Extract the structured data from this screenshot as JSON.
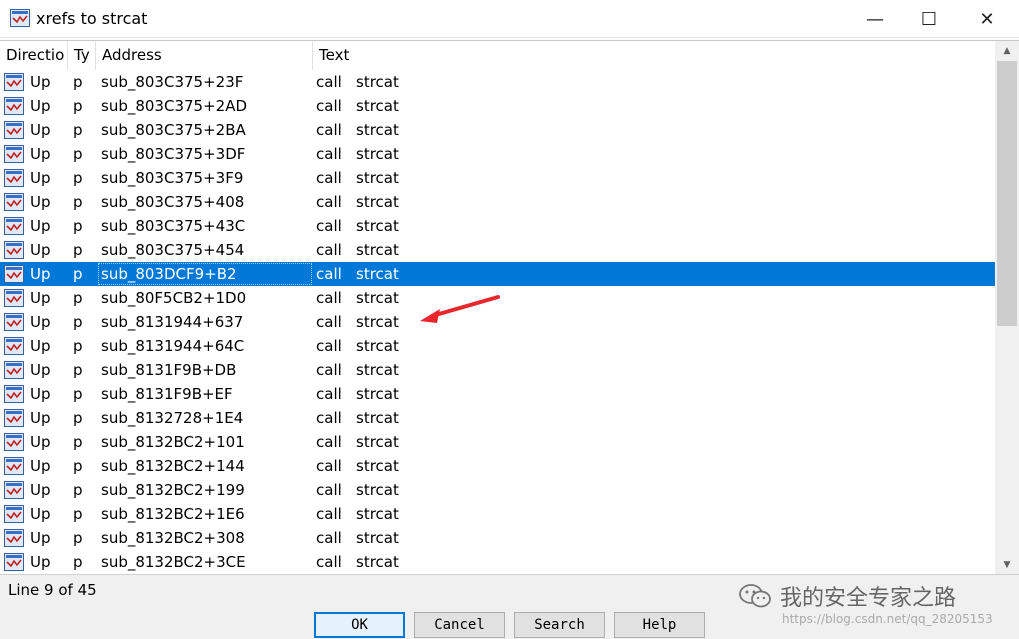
{
  "window": {
    "title": "xrefs to strcat",
    "min_glyph": "—",
    "max_glyph": "☐",
    "close_glyph": "✕",
    "icon": "xref-app-icon"
  },
  "columns": [
    "Directio",
    "Ty",
    "Address",
    "Text"
  ],
  "rows": [
    {
      "dir": "Up",
      "type": "p",
      "address": "sub_803C375+23F",
      "op": "call",
      "target": "strcat"
    },
    {
      "dir": "Up",
      "type": "p",
      "address": "sub_803C375+2AD",
      "op": "call",
      "target": "strcat"
    },
    {
      "dir": "Up",
      "type": "p",
      "address": "sub_803C375+2BA",
      "op": "call",
      "target": "strcat"
    },
    {
      "dir": "Up",
      "type": "p",
      "address": "sub_803C375+3DF",
      "op": "call",
      "target": "strcat"
    },
    {
      "dir": "Up",
      "type": "p",
      "address": "sub_803C375+3F9",
      "op": "call",
      "target": "strcat"
    },
    {
      "dir": "Up",
      "type": "p",
      "address": "sub_803C375+408",
      "op": "call",
      "target": "strcat"
    },
    {
      "dir": "Up",
      "type": "p",
      "address": "sub_803C375+43C",
      "op": "call",
      "target": "strcat"
    },
    {
      "dir": "Up",
      "type": "p",
      "address": "sub_803C375+454",
      "op": "call",
      "target": "strcat"
    },
    {
      "dir": "Up",
      "type": "p",
      "address": "sub_803DCF9+B2",
      "op": "call",
      "target": "strcat",
      "selected": true
    },
    {
      "dir": "Up",
      "type": "p",
      "address": "sub_80F5CB2+1D0",
      "op": "call",
      "target": "strcat"
    },
    {
      "dir": "Up",
      "type": "p",
      "address": "sub_8131944+637",
      "op": "call",
      "target": "strcat"
    },
    {
      "dir": "Up",
      "type": "p",
      "address": "sub_8131944+64C",
      "op": "call",
      "target": "strcat"
    },
    {
      "dir": "Up",
      "type": "p",
      "address": "sub_8131F9B+DB",
      "op": "call",
      "target": "strcat"
    },
    {
      "dir": "Up",
      "type": "p",
      "address": "sub_8131F9B+EF",
      "op": "call",
      "target": "strcat"
    },
    {
      "dir": "Up",
      "type": "p",
      "address": "sub_8132728+1E4",
      "op": "call",
      "target": "strcat"
    },
    {
      "dir": "Up",
      "type": "p",
      "address": "sub_8132BC2+101",
      "op": "call",
      "target": "strcat"
    },
    {
      "dir": "Up",
      "type": "p",
      "address": "sub_8132BC2+144",
      "op": "call",
      "target": "strcat"
    },
    {
      "dir": "Up",
      "type": "p",
      "address": "sub_8132BC2+199",
      "op": "call",
      "target": "strcat"
    },
    {
      "dir": "Up",
      "type": "p",
      "address": "sub_8132BC2+1E6",
      "op": "call",
      "target": "strcat"
    },
    {
      "dir": "Up",
      "type": "p",
      "address": "sub_8132BC2+308",
      "op": "call",
      "target": "strcat"
    },
    {
      "dir": "Up",
      "type": "p",
      "address": "sub_8132BC2+3CE",
      "op": "call",
      "target": "strcat"
    }
  ],
  "status": "Line 9 of 45",
  "buttons": {
    "ok": "OK",
    "cancel": "Cancel",
    "search": "Search",
    "help": "Help"
  },
  "watermark": {
    "text": "我的安全专家之路",
    "url": "https://blog.csdn.net/qq_28205153"
  },
  "colors": {
    "selection": "#0078d7",
    "annotation_arrow": "#e8262b"
  }
}
